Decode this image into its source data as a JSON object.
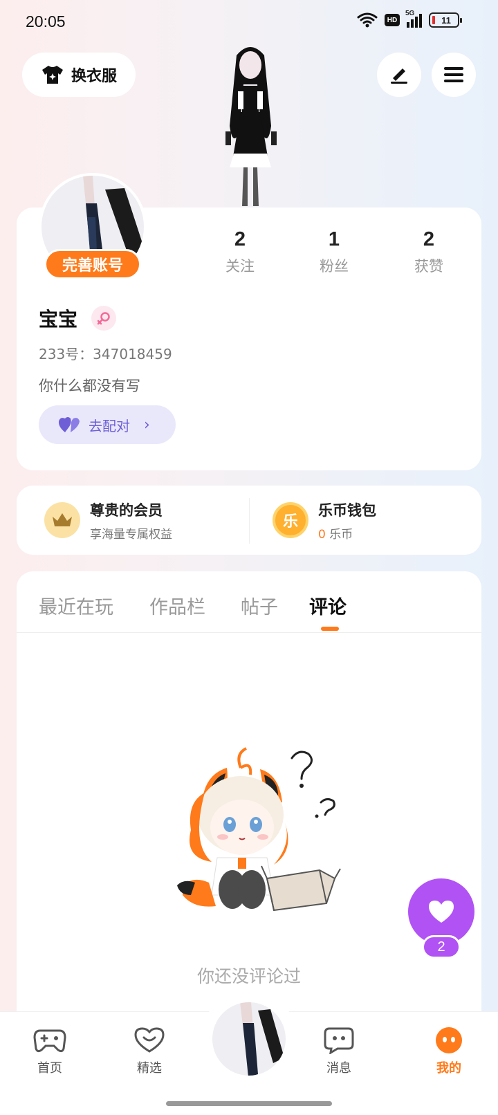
{
  "status_bar": {
    "time": "20:05",
    "hd": "HD",
    "network": "5G",
    "battery": "11"
  },
  "header": {
    "outfit_label": "换衣服"
  },
  "profile": {
    "complete_label": "完善账号",
    "stats": [
      {
        "value": "2",
        "label": "关注"
      },
      {
        "value": "1",
        "label": "粉丝"
      },
      {
        "value": "2",
        "label": "获赞"
      }
    ],
    "nickname": "宝宝",
    "id_text": "233号：347018459",
    "bio": "你什么都没有写",
    "match_label": "去配对"
  },
  "vip": {
    "title": "尊贵的会员",
    "subtitle": "享海量专属权益"
  },
  "wallet": {
    "title": "乐币钱包",
    "amount": "0",
    "unit": "乐币",
    "icon_char": "乐"
  },
  "tabs": [
    {
      "label": "最近在玩"
    },
    {
      "label": "作品栏"
    },
    {
      "label": "帖子"
    },
    {
      "label": "评论"
    }
  ],
  "empty_state": {
    "text": "你还没评论过"
  },
  "fab": {
    "like_count": "2"
  },
  "bottom_nav": [
    {
      "label": "首页"
    },
    {
      "label": "精选"
    },
    {
      "label": "消息"
    },
    {
      "label": "我的"
    }
  ],
  "colors": {
    "accent": "#ff7a1a",
    "purple": "#b152f5",
    "match": "#6e5fd6"
  }
}
